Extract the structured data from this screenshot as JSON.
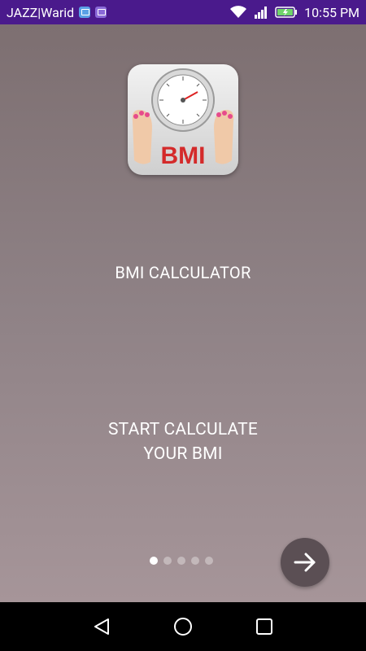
{
  "status_bar": {
    "carrier": "JAZZ|Warid",
    "time": "10:55 PM",
    "icons": [
      "notification-app-icon",
      "notification-image-icon",
      "wifi-icon",
      "signal-icon",
      "battery-charging-icon"
    ]
  },
  "app": {
    "logo_text": "BMI",
    "title": "BMI CALCULATOR",
    "tagline_line1": "START CALCULATE",
    "tagline_line2": "YOUR BMI"
  },
  "pager": {
    "total": 5,
    "active_index": 0
  },
  "next_button": {
    "icon": "arrow-right-icon"
  },
  "nav_bar": {
    "buttons": [
      "back-icon",
      "home-icon",
      "recents-icon"
    ]
  },
  "colors": {
    "status_bar": "#4a1a8c",
    "bg_top": "#7d6f71",
    "bg_bottom": "#a69599",
    "next_button": "#5b4f54"
  }
}
